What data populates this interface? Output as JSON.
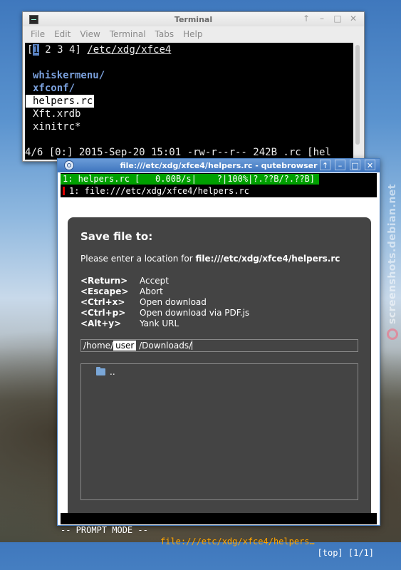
{
  "watermark": {
    "text": "screenshots.debian.net"
  },
  "terminal": {
    "title": "Terminal",
    "menu": [
      "File",
      "Edit",
      "View",
      "Terminal",
      "Tabs",
      "Help"
    ],
    "tabs_line": {
      "open": "[",
      "active": "1",
      "rest": " 2 3 4]",
      "path": "/etc/xdg/xfce4"
    },
    "entries": [
      {
        "name": "whiskermenu/",
        "type": "dir"
      },
      {
        "name": "xfconf/",
        "type": "dir"
      },
      {
        "name": "helpers.rc",
        "type": "selected"
      },
      {
        "name": "Xft.xrdb",
        "type": "file"
      },
      {
        "name": "xinitrc*",
        "type": "file"
      }
    ],
    "status": "4/6 [0:] 2015-Sep-20 15:01 -rw-r--r-- 242B .rc [hel"
  },
  "qutebrowser": {
    "title": "file:///etc/xdg/xfce4/helpers.rc - qutebrowser",
    "download_bar": "1: helpers.rc [   0.00B/s|    ?|100%|?.??B/?.??B]",
    "tab_bar": "1: file:///etc/xdg/xfce4/helpers.rc",
    "prompt": {
      "title": "Save file to:",
      "text_prefix": "Please enter a location for ",
      "text_url": "file:///etc/xdg/xfce4/helpers.rc",
      "keys": [
        {
          "key": "<Return>",
          "action": "Accept"
        },
        {
          "key": "<Escape>",
          "action": "Abort"
        },
        {
          "key": "<Ctrl+x>",
          "action": "Open download"
        },
        {
          "key": "<Ctrl+p>",
          "action": "Open download via PDF.js"
        },
        {
          "key": "<Alt+y>",
          "action": "Yank URL"
        }
      ],
      "path_prefix": "/home/",
      "path_user": "user",
      "path_suffix": "/Downloads/",
      "files": [
        ".."
      ]
    },
    "statusbar": {
      "mode": "-- PROMPT MODE --",
      "url": "file:///etc/xdg/xfce4/helpers…",
      "position": "[top] [1/1]"
    }
  }
}
